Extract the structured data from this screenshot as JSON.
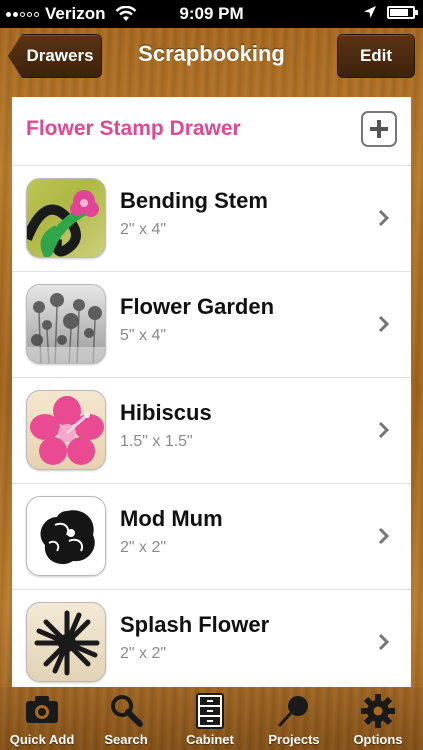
{
  "status": {
    "carrier": "Verizon",
    "time": "9:09 PM"
  },
  "nav": {
    "back_label": "Drawers",
    "title": "Scrapbooking",
    "edit_label": "Edit"
  },
  "drawer": {
    "title": "Flower Stamp Drawer",
    "items": [
      {
        "name": "Bending Stem",
        "size": "2\" x 4\""
      },
      {
        "name": "Flower Garden",
        "size": "5\" x 4\""
      },
      {
        "name": "Hibiscus",
        "size": "1.5\" x 1.5\""
      },
      {
        "name": "Mod Mum",
        "size": "2\" x 2\""
      },
      {
        "name": "Splash Flower",
        "size": "2\" x 2\""
      }
    ]
  },
  "tabs": [
    {
      "label": "Quick Add",
      "icon": "camera-icon"
    },
    {
      "label": "Search",
      "icon": "search-icon"
    },
    {
      "label": "Cabinet",
      "icon": "cabinet-icon"
    },
    {
      "label": "Projects",
      "icon": "pushpin-icon"
    },
    {
      "label": "Options",
      "icon": "gear-icon"
    }
  ],
  "colors": {
    "accent": "#e0488f",
    "wood": "#a8691f",
    "button": "#4a2a10"
  }
}
